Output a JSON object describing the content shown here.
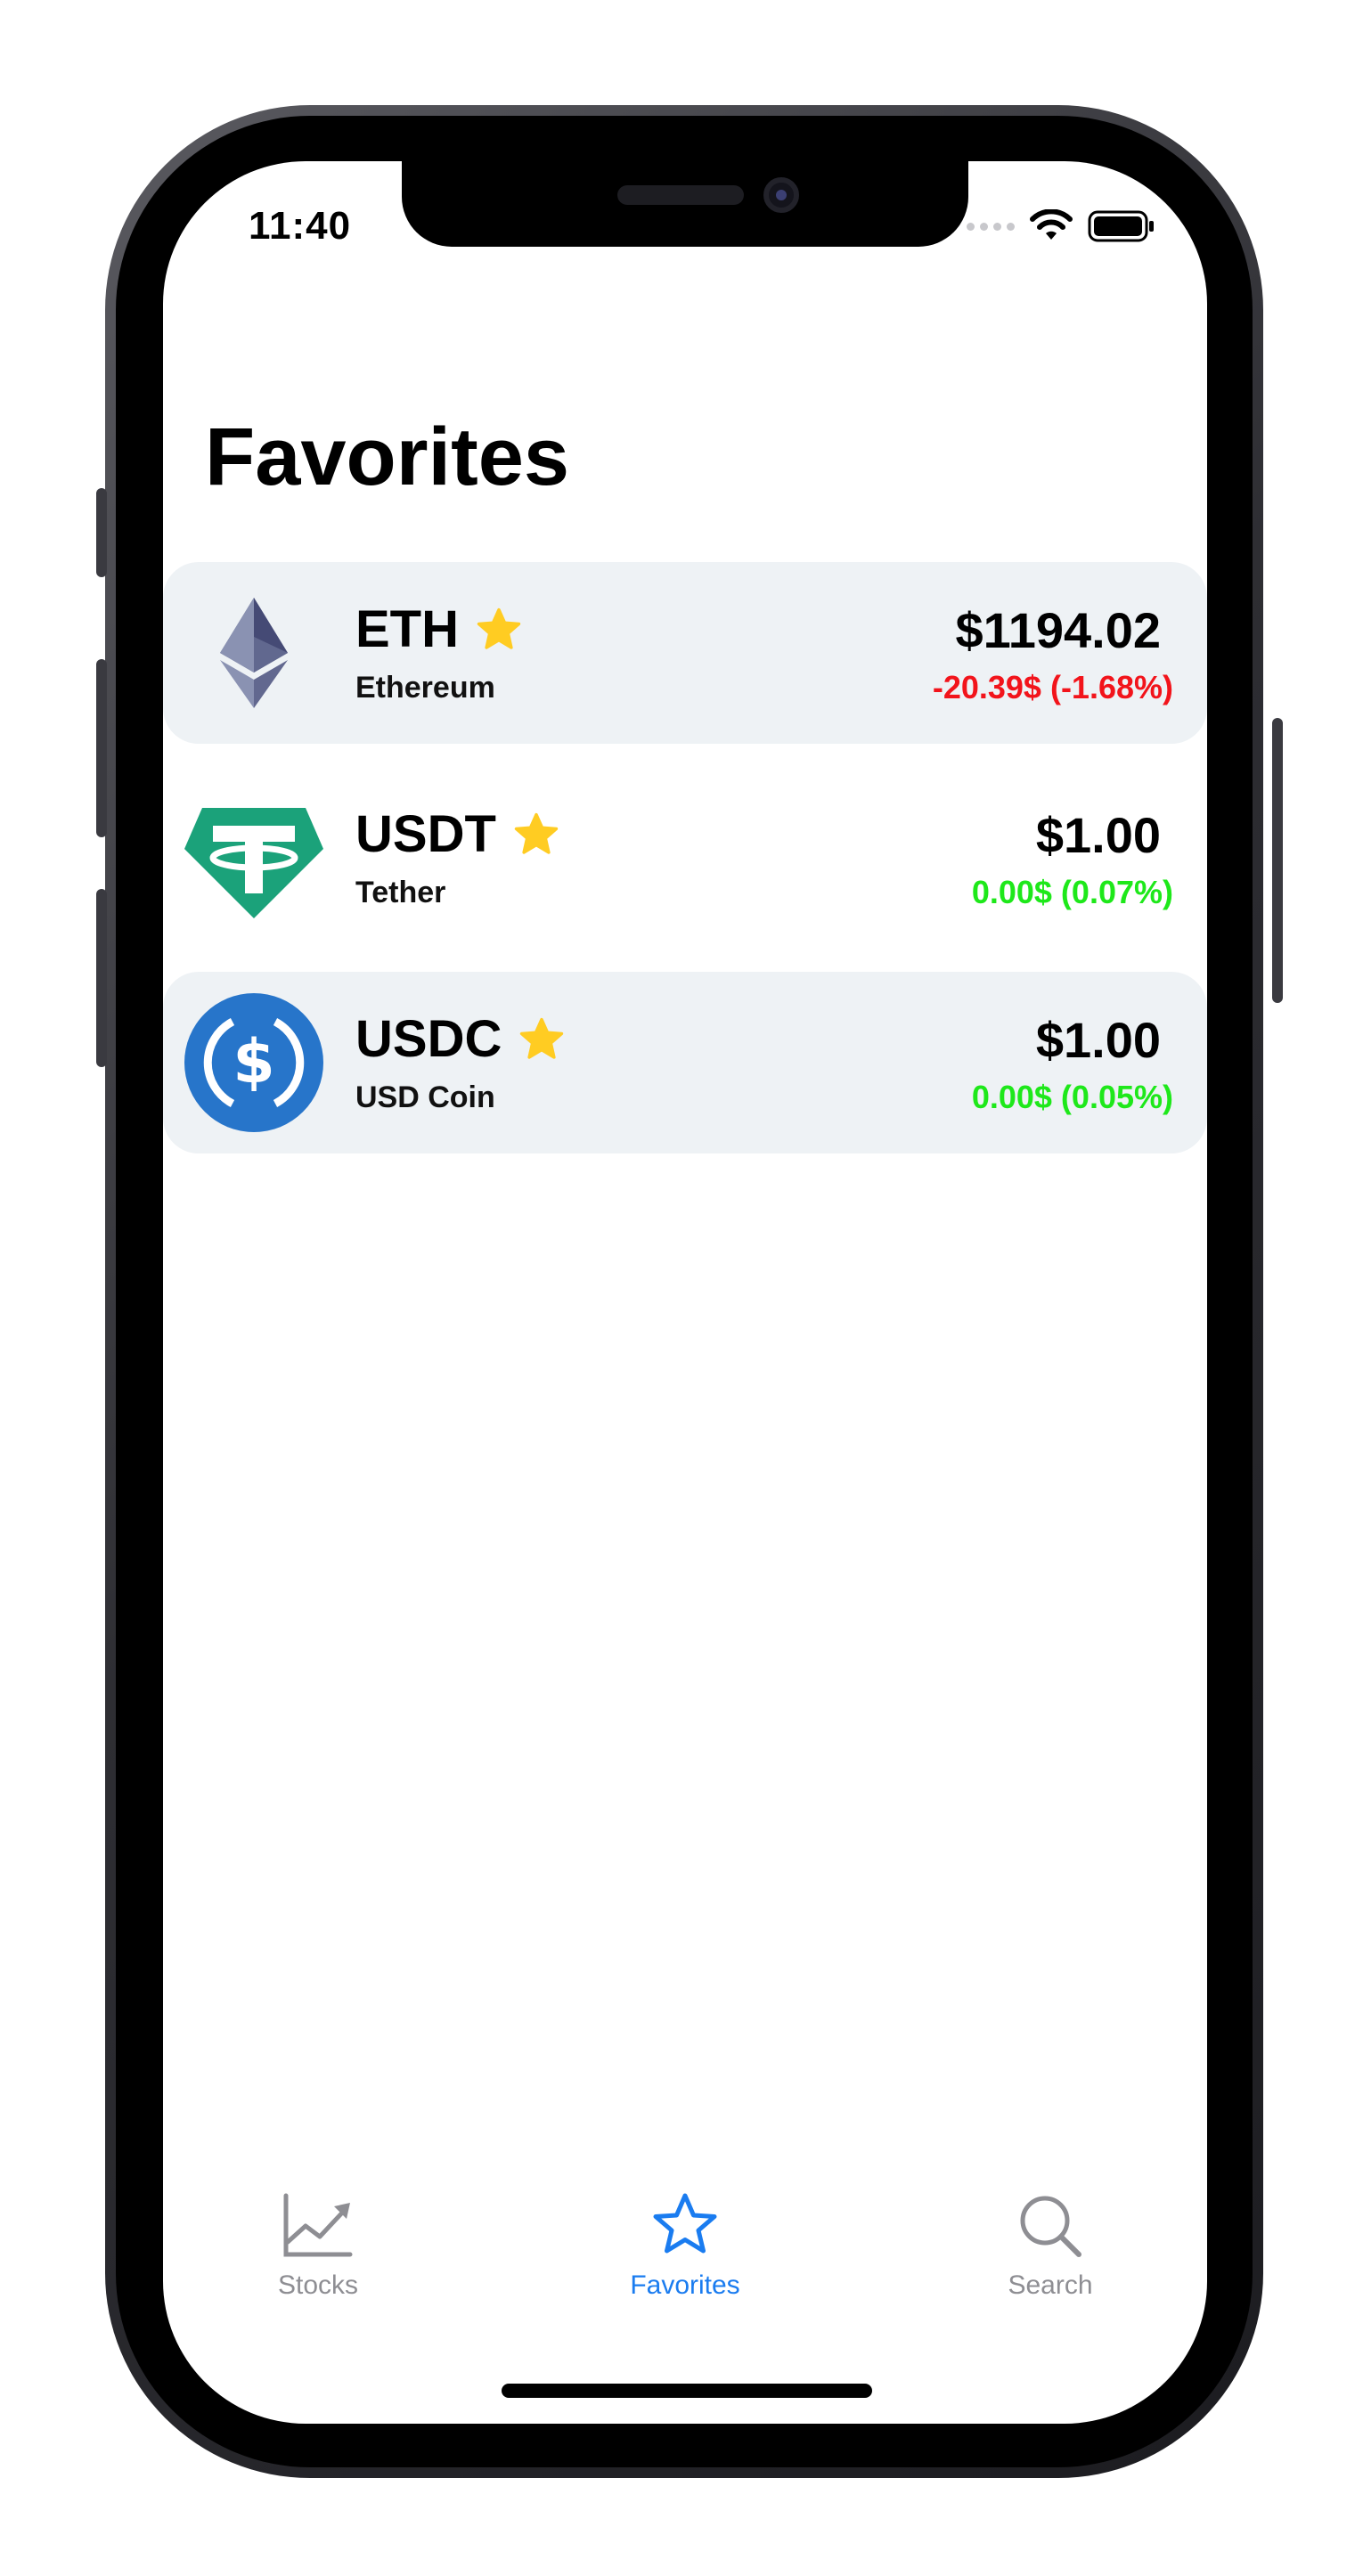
{
  "status_bar": {
    "time": "11:40"
  },
  "page": {
    "title": "Favorites"
  },
  "coins": [
    {
      "symbol": "ETH",
      "name": "Ethereum",
      "price": "$1194.02",
      "change": "-20.39$ (-1.68%)",
      "trend": "down",
      "logo": "ethereum-logo",
      "favorite": true
    },
    {
      "symbol": "USDT",
      "name": "Tether",
      "price": "$1.00",
      "change": "0.00$ (0.07%)",
      "trend": "up",
      "logo": "tether-logo",
      "favorite": true
    },
    {
      "symbol": "USDC",
      "name": "USD Coin",
      "price": "$1.00",
      "change": "0.00$ (0.05%)",
      "trend": "up",
      "logo": "usd-coin-logo",
      "favorite": true
    }
  ],
  "tabs": [
    {
      "label": "Stocks",
      "icon": "chart-icon",
      "active": false
    },
    {
      "label": "Favorites",
      "icon": "star-icon",
      "active": true
    },
    {
      "label": "Search",
      "icon": "search-icon",
      "active": false
    }
  ],
  "colors": {
    "negative": "#f2141b",
    "positive": "#1ee81a",
    "accent": "#1a7cf0",
    "star": "#ffcc22",
    "row_shade": "#eef2f5"
  }
}
